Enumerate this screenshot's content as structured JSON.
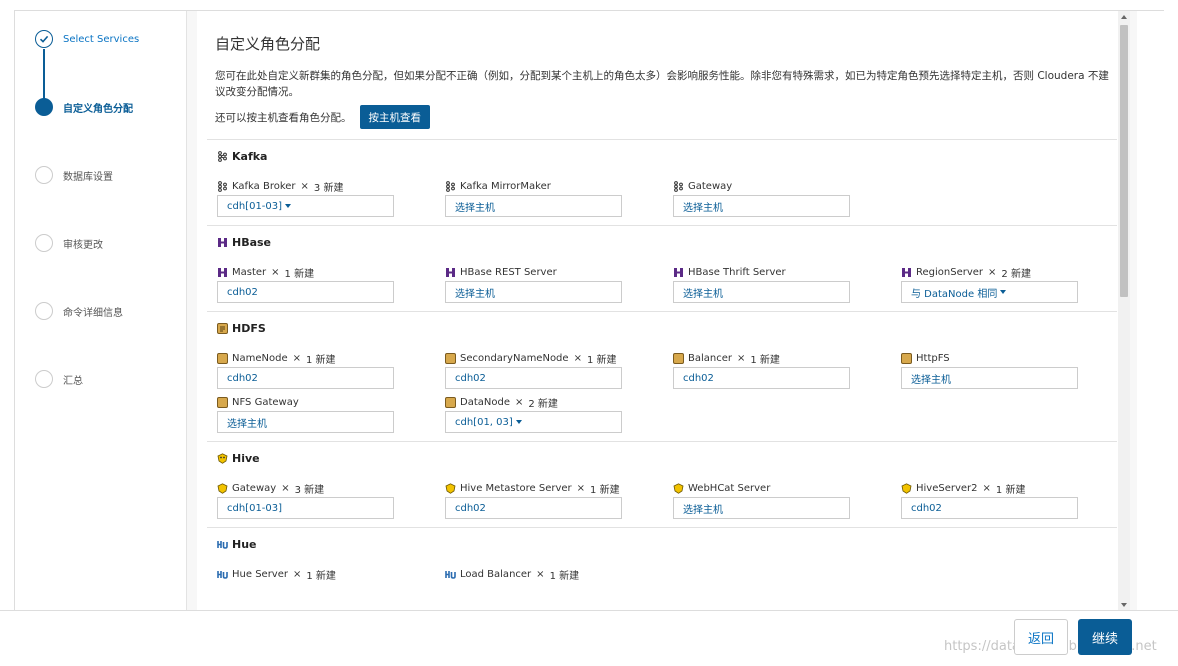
{
  "colors": {
    "accent": "#0a5d96",
    "link": "#0a74c4"
  },
  "wizard": {
    "steps": [
      {
        "label": "Select Services",
        "state": "done"
      },
      {
        "label": "自定义角色分配",
        "state": "current"
      },
      {
        "label": "数据库设置",
        "state": "pending"
      },
      {
        "label": "审核更改",
        "state": "pending"
      },
      {
        "label": "命令详细信息",
        "state": "pending"
      },
      {
        "label": "汇总",
        "state": "pending"
      }
    ]
  },
  "page": {
    "title": "自定义角色分配",
    "description": "您可在此处自定义新群集的角色分配，但如果分配不正确（例如，分配到某个主机上的角色太多）会影响服务性能。除非您有特殊需求，如已为特定角色预先选择特定主机，否则 Cloudera 不建议改变分配情况。",
    "view_by_host_text": "还可以按主机查看角色分配。",
    "view_by_host_button": "按主机查看"
  },
  "services": {
    "kafka": {
      "name": "Kafka",
      "icon": "kafka-icon",
      "roles": [
        {
          "name": "Kafka Broker",
          "times": "×",
          "count": "3 新建",
          "value": "cdh[01-03]",
          "dropdown": true
        },
        {
          "name": "Kafka MirrorMaker",
          "value": "选择主机"
        },
        {
          "name": "Gateway",
          "value": "选择主机"
        }
      ]
    },
    "hbase": {
      "name": "HBase",
      "icon": "hbase-icon",
      "roles": [
        {
          "name": "Master",
          "times": "×",
          "count": "1 新建",
          "value": "cdh02"
        },
        {
          "name": "HBase REST Server",
          "value": "选择主机"
        },
        {
          "name": "HBase Thrift Server",
          "value": "选择主机"
        },
        {
          "name": "RegionServer",
          "times": "×",
          "count": "2 新建",
          "value": "与 DataNode 相同",
          "dropdown": true
        }
      ]
    },
    "hdfs": {
      "name": "HDFS",
      "icon": "hdfs-icon",
      "roles": [
        {
          "name": "NameNode",
          "times": "×",
          "count": "1 新建",
          "value": "cdh02"
        },
        {
          "name": "SecondaryNameNode",
          "times": "×",
          "count": "1 新建",
          "value": "cdh02"
        },
        {
          "name": "Balancer",
          "times": "×",
          "count": "1 新建",
          "value": "cdh02"
        },
        {
          "name": "HttpFS",
          "value": "选择主机"
        },
        {
          "name": "NFS Gateway",
          "value": "选择主机"
        },
        {
          "name": "DataNode",
          "times": "×",
          "count": "2 新建",
          "value": "cdh[01, 03]",
          "dropdown": true
        }
      ]
    },
    "hive": {
      "name": "Hive",
      "icon": "hive-icon",
      "roles": [
        {
          "name": "Gateway",
          "times": "×",
          "count": "3 新建",
          "value": "cdh[01-03]"
        },
        {
          "name": "Hive Metastore Server",
          "times": "×",
          "count": "1 新建",
          "value": "cdh02"
        },
        {
          "name": "WebHCat Server",
          "value": "选择主机"
        },
        {
          "name": "HiveServer2",
          "times": "×",
          "count": "1 新建",
          "value": "cdh02"
        }
      ]
    },
    "hue": {
      "name": "Hue",
      "icon": "hue-icon",
      "roles": [
        {
          "name": "Hue Server",
          "times": "×",
          "count": "1 新建"
        },
        {
          "name": "Load Balancer",
          "times": "×",
          "count": "1 新建"
        }
      ]
    }
  },
  "footer": {
    "back": "返回",
    "continue": "继续",
    "watermark": "https://datamining.blog.csdn.net"
  }
}
